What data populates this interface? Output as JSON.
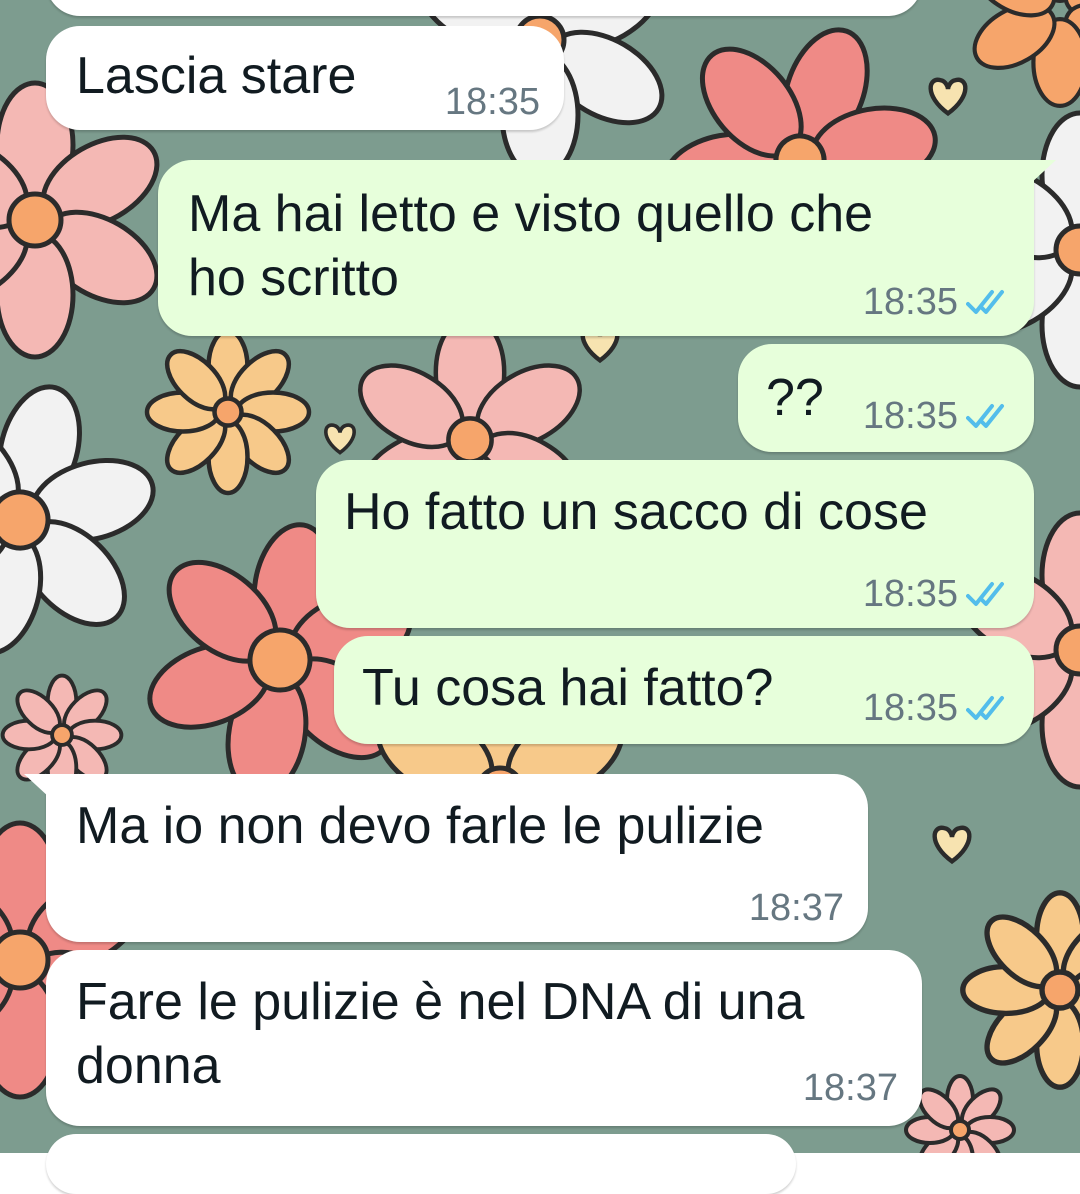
{
  "colors": {
    "wallpaper": "#7d9c8f",
    "incoming_bubble": "#ffffff",
    "outgoing_bubble": "#e7ffdb",
    "text": "#111b21",
    "meta": "#667781",
    "read_ticks": "#53bdeb"
  },
  "messages": [
    {
      "direction": "incoming",
      "text": "Lascia stare",
      "time": "18:35"
    },
    {
      "direction": "outgoing",
      "text": "Ma hai letto e visto quello che\nho scritto",
      "time": "18:35",
      "status": "read-double-tick-icon"
    },
    {
      "direction": "outgoing",
      "text": "??",
      "time": "18:35",
      "status": "read-double-tick-icon"
    },
    {
      "direction": "outgoing",
      "text": "Ho fatto un sacco di cose",
      "time": "18:35",
      "status": "read-double-tick-icon"
    },
    {
      "direction": "outgoing",
      "text": "Tu cosa hai fatto?",
      "time": "18:35",
      "status": "read-double-tick-icon"
    },
    {
      "direction": "incoming",
      "text": "Ma io non devo farle le pulizie",
      "time": "18:37"
    },
    {
      "direction": "incoming",
      "text": "Fare le pulizie è nel DNA di una\ndonna",
      "time": "18:37"
    }
  ]
}
